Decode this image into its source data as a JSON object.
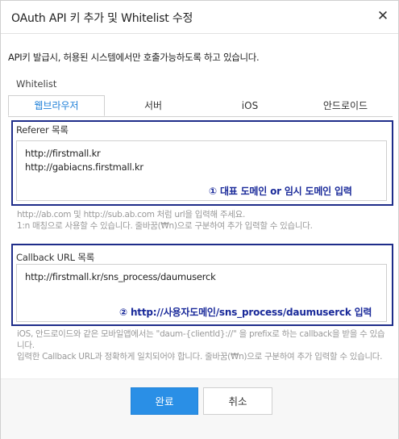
{
  "dialog": {
    "title": "OAuth API 키 추가 및 Whitelist 수정",
    "close_glyph": "✕"
  },
  "intro": "API키 발급시, 허용된 시스템에서만 호출가능하도록 하고 있습니다.",
  "whitelist_label": "Whitelist",
  "tabs": [
    {
      "label": "웹브라우저",
      "active": true
    },
    {
      "label": "서버",
      "active": false
    },
    {
      "label": "iOS",
      "active": false
    },
    {
      "label": "안드로이드",
      "active": false
    }
  ],
  "referer": {
    "label": "Referer 목록",
    "lines": [
      "http://firstmall.kr",
      "http://gabiacns.firstmall.kr"
    ],
    "annotation": "① 대표 도메인 or 임시 도메인 입력",
    "help": [
      "http://ab.com 및 http://sub.ab.com 처럼 url을 입력해 주세요.",
      "1:n 매칭으로 사용할 수 있습니다. 줄바꿈(₩n)으로 구분하여 추가 입력할 수 있습니다."
    ]
  },
  "callback": {
    "label": "Callback URL 목록",
    "lines": [
      "http://firstmall.kr/sns_process/daumuserck"
    ],
    "annotation": "② http://사용자도메인/sns_process/daumuserck 입력",
    "help": [
      "iOS, 안드로이드와 같은 모바일앱에서는 \"daum-{clientId}://\" 을 prefix로 하는 callback을 받을 수 있습니다.",
      "입력한 Callback URL과 정확하게 일치되어야 합니다. 줄바꿈(₩n)으로 구분하여 추가 입력할 수 있습니다."
    ]
  },
  "buttons": {
    "ok": "완료",
    "cancel": "취소"
  },
  "colors": {
    "accent": "#2a8fe6",
    "annotation_box": "#1f2d8a",
    "annotation_text": "#1a2a9a"
  }
}
